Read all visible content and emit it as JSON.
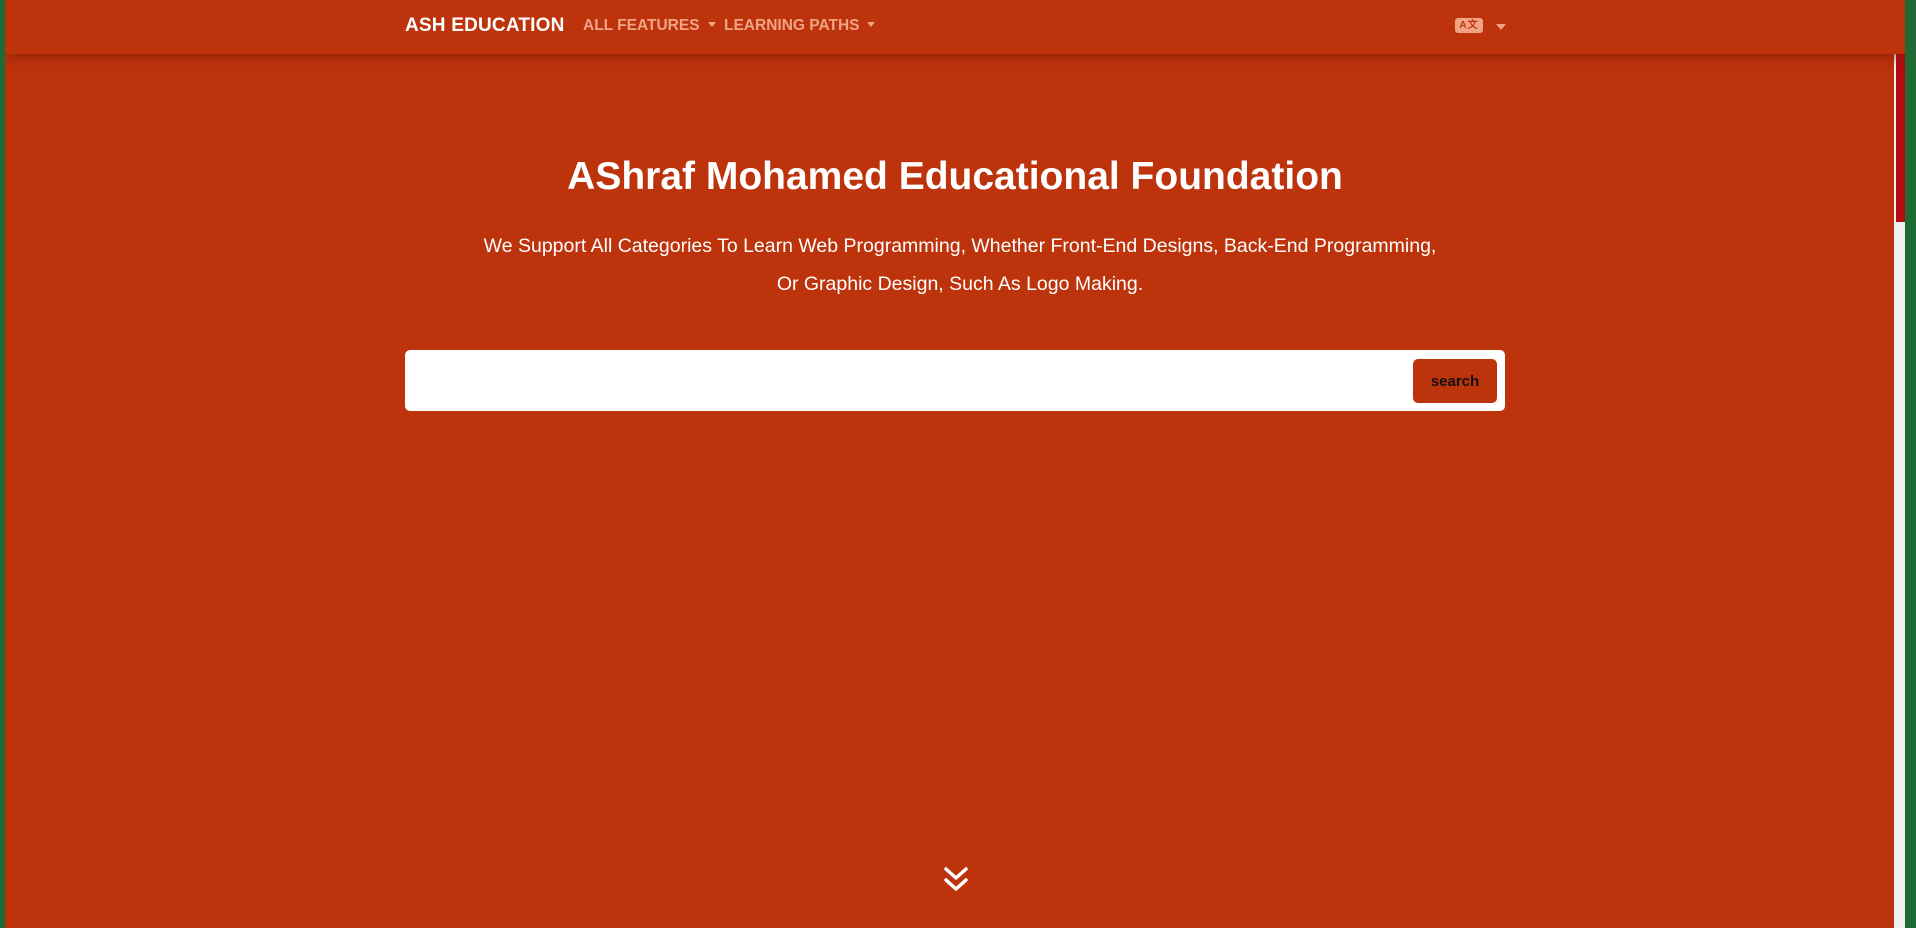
{
  "navbar": {
    "brand": "ASH EDUCATION",
    "items": [
      {
        "label": "ALL FEATURES"
      },
      {
        "label": "LEARNING PATHS"
      }
    ],
    "language_icon": "translate-icon"
  },
  "hero": {
    "title": "AShraf Mohamed Educational Foundation",
    "subtitle_line1": "We Support All Categories To Learn Web Programming, Whether Front-End Designs, Back-End Programming,",
    "subtitle_line2": "Or Graphic Design, Such As Logo Making."
  },
  "search": {
    "value": "",
    "placeholder": "",
    "button_label": "search"
  },
  "scroll_icon": "double-chevron-down-icon",
  "colors": {
    "background": "#bd330b",
    "nav_link": "#f1a485",
    "text": "#ffffff",
    "left_edge": "#1f6b35",
    "scrollbar_thumb": "#b30d0d"
  }
}
